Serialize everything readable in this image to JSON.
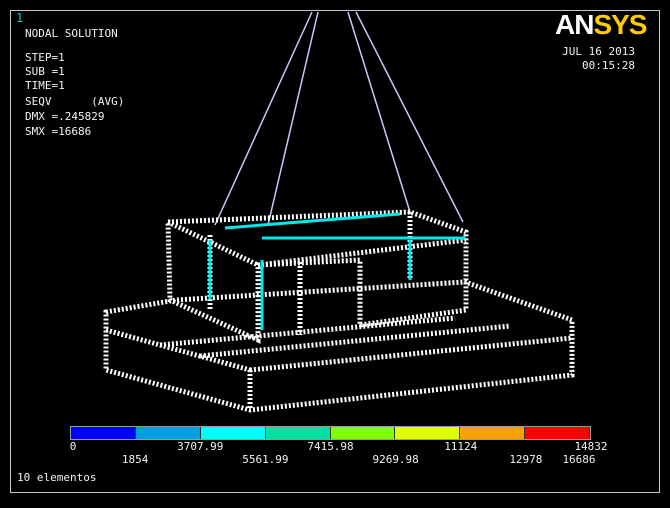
{
  "window_number": "1",
  "logo": {
    "ans": "AN",
    "sys": "SYS"
  },
  "date": "JUL 16 2013",
  "time": "00:15:28",
  "info": {
    "title": "NODAL SOLUTION",
    "step": "STEP=1",
    "sub": "SUB =1",
    "time": "TIME=1",
    "seqv": "SEQV      (AVG)",
    "dmx": "DMX =.245829",
    "smx": "SMX =16686"
  },
  "legend": {
    "colors": [
      "#0000ff",
      "#00a0e0",
      "#00ffff",
      "#00e0a0",
      "#80ff00",
      "#e0ff00",
      "#ffa000",
      "#ff0000"
    ],
    "top_labels": [
      "0",
      "3707.99",
      "7415.98",
      "11124",
      "14832"
    ],
    "bottom_labels": [
      "1854",
      "5561.99",
      "9269.98",
      "12978",
      "16686"
    ]
  },
  "footer": "10 elementos"
}
